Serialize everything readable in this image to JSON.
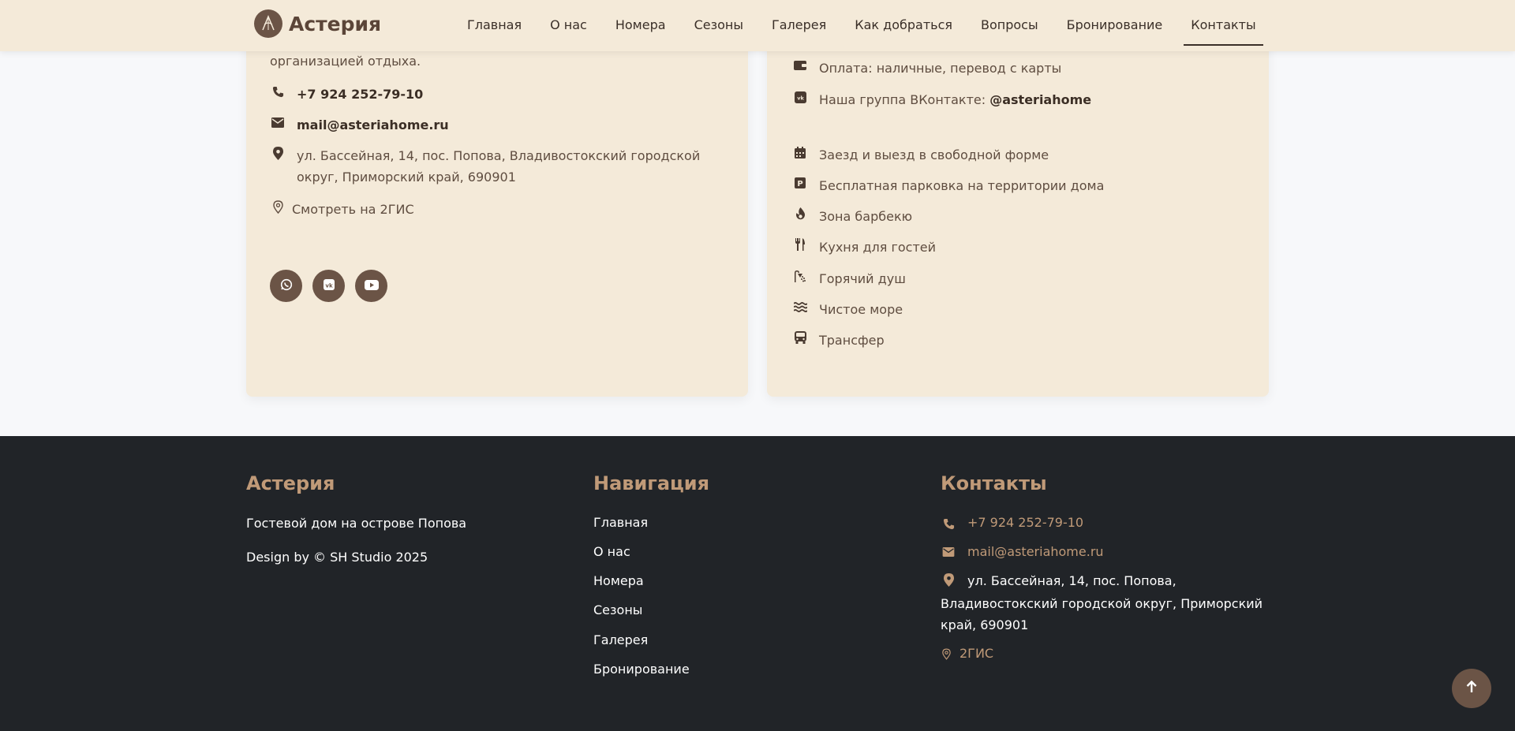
{
  "header": {
    "brand": "Астерия",
    "nav": [
      {
        "label": "Главная"
      },
      {
        "label": "О нас"
      },
      {
        "label": "Номера"
      },
      {
        "label": "Сезоны"
      },
      {
        "label": "Галерея"
      },
      {
        "label": "Как добраться"
      },
      {
        "label": "Вопросы"
      },
      {
        "label": "Бронирование"
      },
      {
        "label": "Контакты",
        "active": true
      }
    ]
  },
  "contacts_card": {
    "intro_tail": "организацией отдыха.",
    "phone": "+7 924 252-79-10",
    "email": "mail@asteriahome.ru",
    "address": "ул. Бассейная, 14, пос. Попова, Владивостокский городской округ, Приморский край, 690901",
    "map_link": "Смотреть на 2ГИС",
    "social": [
      {
        "icon": "whatsapp-icon"
      },
      {
        "icon": "vk-icon"
      },
      {
        "icon": "youtube-icon"
      }
    ]
  },
  "info_card": {
    "payment": "Оплата: наличные, перевод с карты",
    "vk_prefix": "Наша группа ВКонтакте: ",
    "vk_handle": "@asteriahome",
    "amenities": [
      {
        "icon": "calendar-icon",
        "label": "Заезд и выезд в свободной форме"
      },
      {
        "icon": "parking-icon",
        "label": "Бесплатная парковка на территории дома"
      },
      {
        "icon": "fire-icon",
        "label": "Зона барбекю"
      },
      {
        "icon": "utensils-icon",
        "label": "Кухня для гостей"
      },
      {
        "icon": "shower-icon",
        "label": "Горячий душ"
      },
      {
        "icon": "water-icon",
        "label": "Чистое море"
      },
      {
        "icon": "bus-icon",
        "label": "Трансфер"
      }
    ]
  },
  "footer": {
    "brand": {
      "title": "Астерия",
      "tagline": "Гостевой дом на острове Попова",
      "credit": "Design by © SH Studio 2025"
    },
    "navigation": {
      "title": "Навигация",
      "links": [
        "Главная",
        "О нас",
        "Номера",
        "Сезоны",
        "Галерея",
        "Бронирование"
      ]
    },
    "contacts": {
      "title": "Контакты",
      "phone": "+7 924 252-79-10",
      "email": "mail@asteriahome.ru",
      "address": "ул. Бассейная, 14, пос. Попова, Владивостокский городской округ, Приморский край, 690901",
      "map_link": "2ГИС"
    }
  },
  "colors": {
    "header_bg": "#f4ead9",
    "card_bg": "#f4ead9",
    "accent_brown": "#6b5446",
    "footer_bg": "#212428",
    "footer_accent": "#c09a78"
  }
}
